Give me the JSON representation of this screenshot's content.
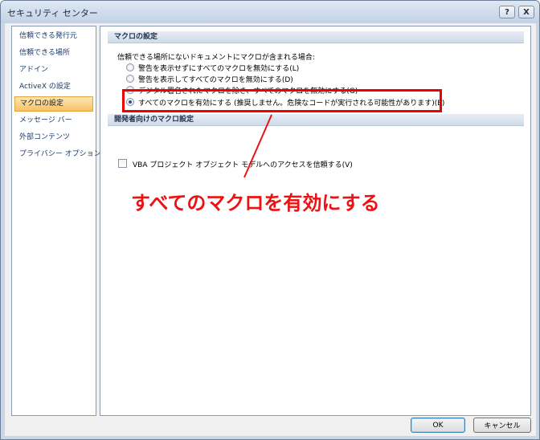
{
  "window": {
    "title": "セキュリティ センター",
    "help_button": "?",
    "close_button": "X"
  },
  "sidebar": {
    "items": [
      {
        "label": "信頼できる発行元",
        "active": false
      },
      {
        "label": "信頼できる場所",
        "active": false
      },
      {
        "label": "アドイン",
        "active": false
      },
      {
        "label": "ActiveX の設定",
        "active": false
      },
      {
        "label": "マクロの設定",
        "active": true
      },
      {
        "label": "メッセージ バー",
        "active": false
      },
      {
        "label": "外部コンテンツ",
        "active": false
      },
      {
        "label": "プライバシー オプション",
        "active": false
      }
    ]
  },
  "macro_settings": {
    "heading": "マクロの設定",
    "intro": "信頼できる場所にないドキュメントにマクロが含まれる場合:",
    "options": [
      {
        "label": "警告を表示せずにすべてのマクロを無効にする(L)",
        "checked": false
      },
      {
        "label": "警告を表示してすべてのマクロを無効にする(D)",
        "checked": false
      },
      {
        "label": "デジタル署名されたマクロを除き、すべてのマクロを無効にする(G)",
        "checked": false
      },
      {
        "label": "すべてのマクロを有効にする (推奨しません。危険なコードが実行される可能性があります)(E)",
        "checked": true
      }
    ]
  },
  "developer_settings": {
    "heading": "開発者向けのマクロ設定",
    "vba_trust_label": "VBA プロジェクト オブジェクト モデルへのアクセスを信頼する(V)",
    "vba_trust_checked": false
  },
  "annotation": {
    "text": "すべてのマクロを有効にする",
    "color": "#ee1111"
  },
  "buttons": {
    "ok": "OK",
    "cancel": "キャンセル"
  }
}
